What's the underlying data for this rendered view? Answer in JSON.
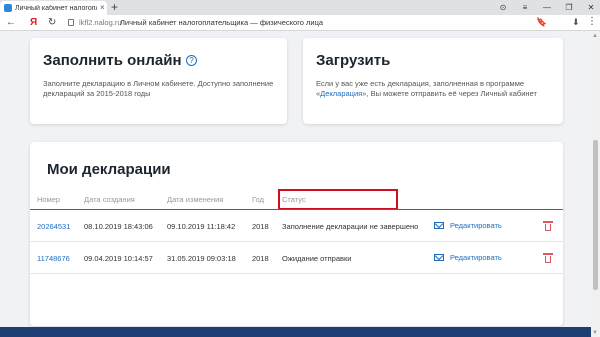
{
  "browser": {
    "tab_title": "Личный кабинет налогоплательщика",
    "tab_close": "×",
    "new_tab": "+",
    "back": "←",
    "yandex_logo": "Я",
    "refresh": "↻",
    "url_host": "lkfl2.nalog.ru",
    "url_title": "Личный кабинет налогоплательщика — физического лица",
    "bookmark_glyph": "🔖",
    "download_glyph": "⬇",
    "menu_glyph": "⋮",
    "controls": [
      "⊙",
      "≡",
      "—",
      "❐",
      "✕"
    ]
  },
  "cards": {
    "fill_online": {
      "title": "Заполнить онлайн",
      "help_glyph": "?",
      "desc_line1": "Заполните декларацию в Личном кабинете. Доступно заполнение",
      "desc_line2": "деклараций за 2015-2018 годы"
    },
    "upload": {
      "title": "Загрузить",
      "desc_part1": "Если у вас уже есть декларация, заполненная в программе «",
      "desc_link": "Декларация",
      "desc_part2": "», Вы можете отправить её через Личный кабинет"
    }
  },
  "declarations": {
    "title": "Мои декларации",
    "columns": [
      "Номер",
      "Дата создания",
      "Дата изменения",
      "Год",
      "Статус"
    ],
    "edit_label": "Редактировать",
    "rows": [
      {
        "number": "20264531",
        "created": "08.10.2019 18:43:06",
        "modified": "09.10.2019 11:18:42",
        "year": "2018",
        "status": "Заполнение декларации не завершено"
      },
      {
        "number": "11748676",
        "created": "09.04.2019 10:14:57",
        "modified": "31.05.2019 09:03:18",
        "year": "2018",
        "status": "Ожидание отправки"
      }
    ]
  },
  "colors": {
    "accent": "#1f6dbe",
    "highlight": "#d10d20",
    "delete": "#e05563",
    "footer": "#1f3e73"
  }
}
